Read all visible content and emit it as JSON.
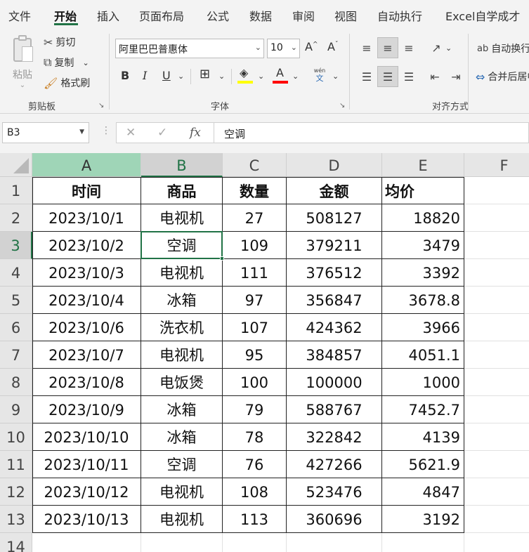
{
  "menu": {
    "tabs": [
      "文件",
      "开始",
      "插入",
      "页面布局",
      "公式",
      "数据",
      "审阅",
      "视图",
      "自动执行",
      "Excel自学成才"
    ],
    "active": "开始"
  },
  "ribbon": {
    "clipboard": {
      "group_label": "剪贴板",
      "paste": "粘贴",
      "cut": "剪切",
      "copy": "复制",
      "format_painter": "格式刷"
    },
    "font": {
      "group_label": "字体",
      "font_name": "阿里巴巴普惠体",
      "font_size": "10",
      "bold": "B",
      "italic": "I",
      "underline": "U",
      "grow": "A",
      "shrink": "A",
      "font_color_glyph": "A",
      "phonetic_top": "wén",
      "phonetic_bottom": "文"
    },
    "alignment": {
      "group_label": "对齐方式",
      "wrap_text": "自动换行",
      "merge_center": "合并后居中"
    }
  },
  "formula_bar": {
    "name_box": "B3",
    "fx": "fx",
    "formula": "空调"
  },
  "grid": {
    "columns": [
      "A",
      "B",
      "C",
      "D",
      "E",
      "F"
    ],
    "row_numbers": [
      "1",
      "2",
      "3",
      "4",
      "5",
      "6",
      "7",
      "8",
      "9",
      "10",
      "11",
      "12",
      "13",
      "14"
    ],
    "headers": [
      "时间",
      "商品",
      "数量",
      "金额",
      "均价"
    ],
    "rows": [
      [
        "2023/10/1",
        "电视机",
        "27",
        "508127",
        "18820"
      ],
      [
        "2023/10/2",
        "空调",
        "109",
        "379211",
        "3479"
      ],
      [
        "2023/10/3",
        "电视机",
        "111",
        "376512",
        "3392"
      ],
      [
        "2023/10/4",
        "冰箱",
        "97",
        "356847",
        "3678.8"
      ],
      [
        "2023/10/6",
        "洗衣机",
        "107",
        "424362",
        "3966"
      ],
      [
        "2023/10/7",
        "电视机",
        "95",
        "384857",
        "4051.1"
      ],
      [
        "2023/10/8",
        "电饭煲",
        "100",
        "100000",
        "1000"
      ],
      [
        "2023/10/9",
        "冰箱",
        "79",
        "588767",
        "7452.7"
      ],
      [
        "2023/10/10",
        "冰箱",
        "78",
        "322842",
        "4139"
      ],
      [
        "2023/10/11",
        "空调",
        "76",
        "427266",
        "5621.9"
      ],
      [
        "2023/10/12",
        "电视机",
        "108",
        "523476",
        "4847"
      ],
      [
        "2023/10/13",
        "电视机",
        "113",
        "360696",
        "3192"
      ]
    ]
  },
  "colors": {
    "accent": "#217346",
    "highlight_bar": "#ffff00",
    "font_color_bar": "#ff0000",
    "col_a_header": "#9fd5b7"
  }
}
